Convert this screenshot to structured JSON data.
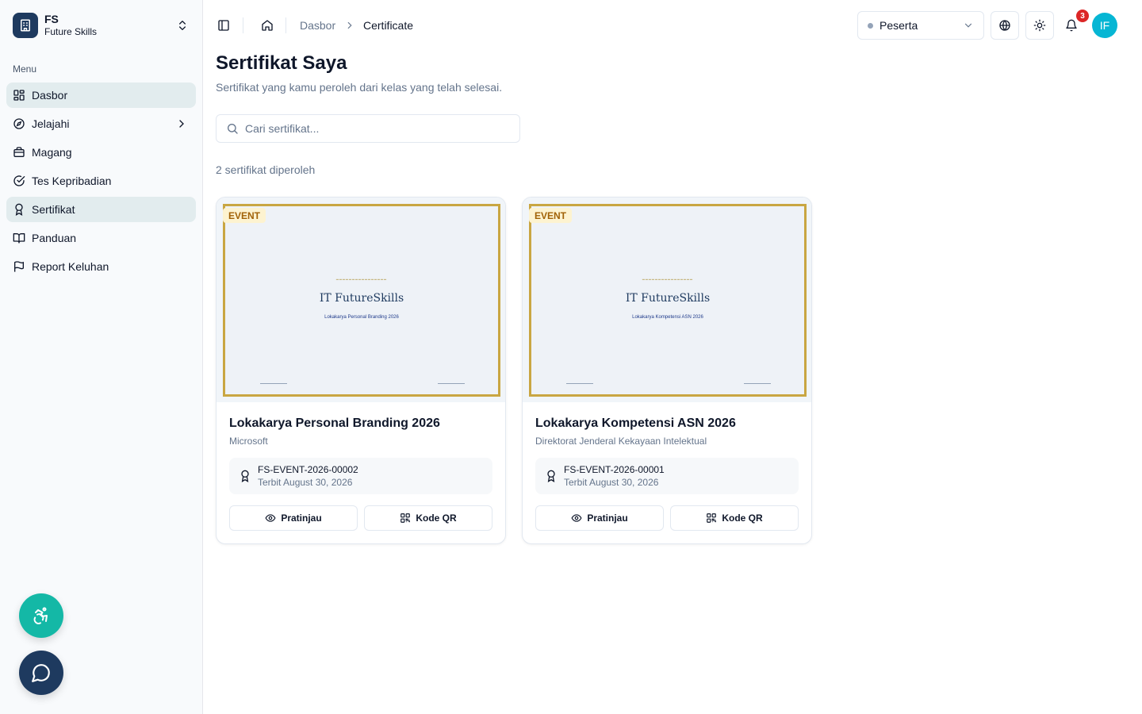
{
  "brand": {
    "abbr": "FS",
    "name": "Future Skills"
  },
  "sidebar": {
    "menu_label": "Menu",
    "items": [
      {
        "label": "Dasbor",
        "icon": "dashboard-icon",
        "active": true
      },
      {
        "label": "Jelajahi",
        "icon": "compass-icon",
        "has_submenu": true
      },
      {
        "label": "Magang",
        "icon": "briefcase-icon"
      },
      {
        "label": "Tes Kepribadian",
        "icon": "check-circle-icon"
      },
      {
        "label": "Sertifikat",
        "icon": "award-icon",
        "active": true
      },
      {
        "label": "Panduan",
        "icon": "book-icon"
      },
      {
        "label": "Report Keluhan",
        "icon": "flag-icon"
      }
    ]
  },
  "header": {
    "breadcrumb": [
      "Dasbor",
      "Certificate"
    ],
    "role": "Peserta",
    "notification_count": "3",
    "avatar_initials": "IF"
  },
  "main": {
    "title": "Sertifikat Saya",
    "subtitle": "Sertifikat yang kamu peroleh dari kelas yang telah selesai.",
    "search_placeholder": "Cari sertifikat...",
    "count_text": "2 sertifikat diperoleh",
    "certificates": [
      {
        "tag": "EVENT",
        "title": "Lokakarya Personal Branding 2026",
        "organizer": "Microsoft",
        "cert_id": "FS-EVENT-2026-00002",
        "issued": "Terbit August 30, 2026",
        "preview_org": "IT FutureSkills",
        "preview_event": "Lokakarya Personal Branding 2026",
        "preview_btn": "Pratinjau",
        "qr_btn": "Kode QR"
      },
      {
        "tag": "EVENT",
        "title": "Lokakarya Kompetensi ASN 2026",
        "organizer": "Direktorat Jenderal Kekayaan Intelektual",
        "cert_id": "FS-EVENT-2026-00001",
        "issued": "Terbit August 30, 2026",
        "preview_org": "IT FutureSkills",
        "preview_event": "Lokakarya Kompetensi ASN 2026",
        "preview_btn": "Pratinjau",
        "qr_btn": "Kode QR"
      }
    ]
  },
  "colors": {
    "accent": "#14b8a6",
    "brand_dark": "#1e3a5f",
    "certificate_border": "#c9a642",
    "badge": "#dc2626",
    "avatar": "#06b6d4"
  }
}
